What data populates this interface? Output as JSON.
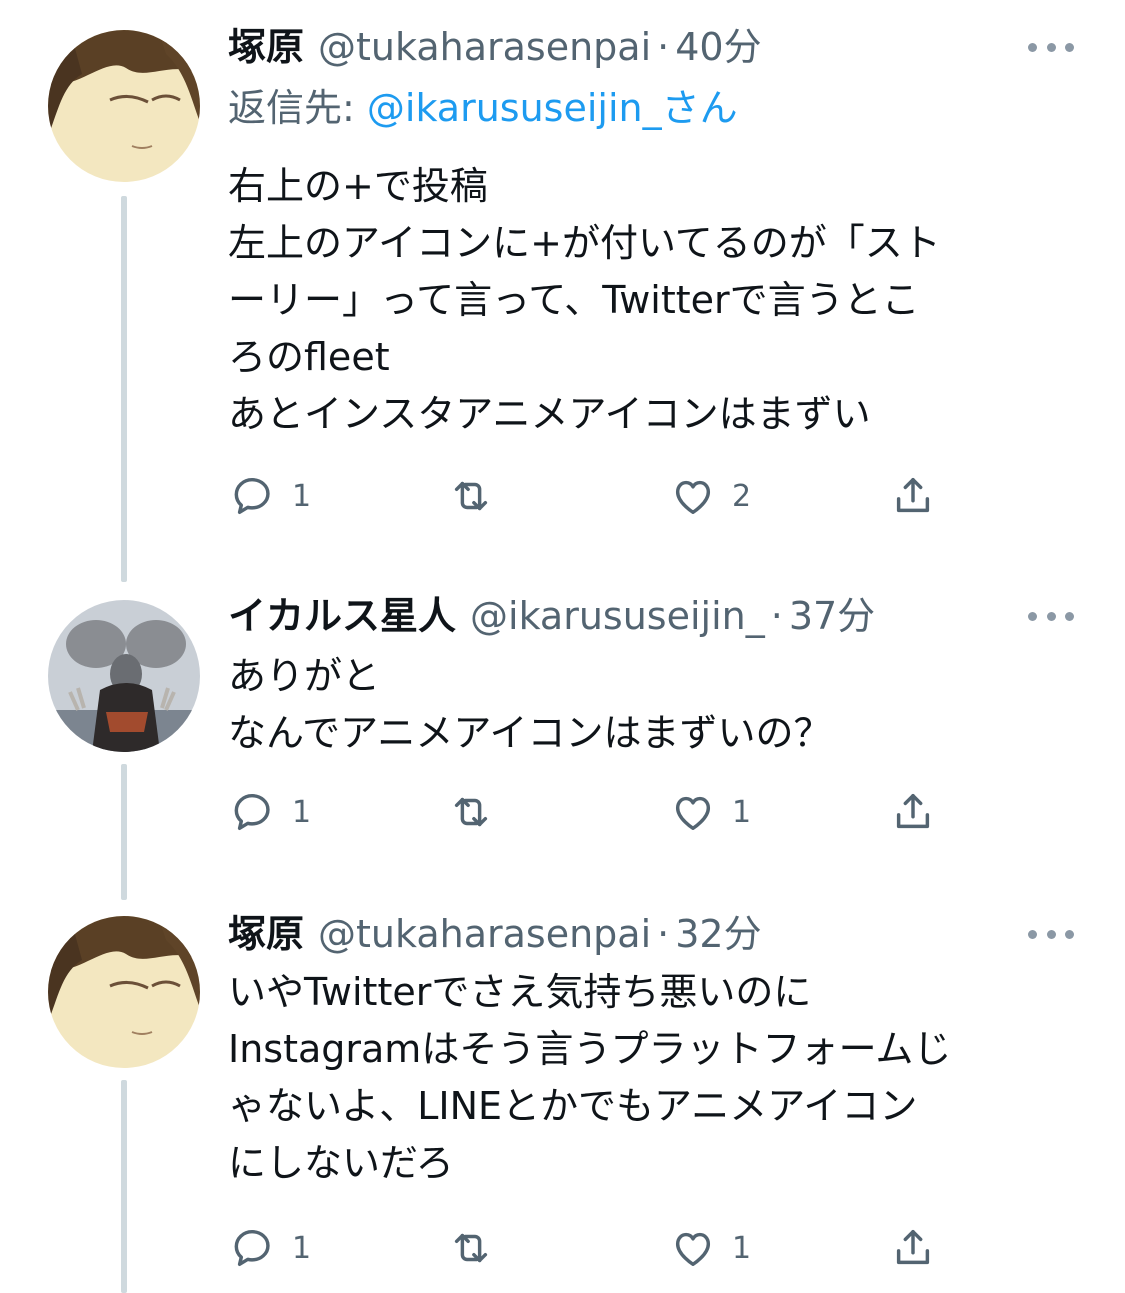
{
  "tweets": [
    {
      "name": "塚原",
      "handle": "@tukaharasenpai",
      "dot": "·",
      "time": "40分",
      "reply_to_label": "返信先: ",
      "reply_to_mention": "@ikarususeijin_さん",
      "lines": [
        "右上の+で投稿",
        "左上のアイコンに+が付いてるのが「スト",
        "ーリー」って言って、Twitterで言うとこ",
        "ろのfleet",
        "あとインスタアニメアイコンはまずい"
      ],
      "reply_count": "1",
      "retweet_count": "",
      "like_count": "2"
    },
    {
      "name": "イカルス星人",
      "handle": "@ikarususeijin_",
      "dot": "·",
      "time": "37分",
      "lines": [
        "ありがと",
        "なんでアニメアイコンはまずいの？"
      ],
      "reply_count": "1",
      "retweet_count": "",
      "like_count": "1"
    },
    {
      "name": "塚原",
      "handle": "@tukaharasenpai",
      "dot": "·",
      "time": "32分",
      "lines": [
        "いやTwitterでさえ気持ち悪いのに",
        "Instagramはそう言うプラットフォームじ",
        "ゃないよ、LINEとかでもアニメアイコン",
        "にしないだろ"
      ],
      "reply_count": "1",
      "retweet_count": "",
      "like_count": "1"
    }
  ],
  "icons": {
    "reply": "reply-icon",
    "retweet": "retweet-icon",
    "like": "heart-icon",
    "share": "share-icon",
    "more": "more-icon"
  },
  "colors": {
    "text": "#0f1419",
    "secondary": "#536471",
    "link": "#1d9bf0",
    "thread_line": "#cfd9de"
  }
}
